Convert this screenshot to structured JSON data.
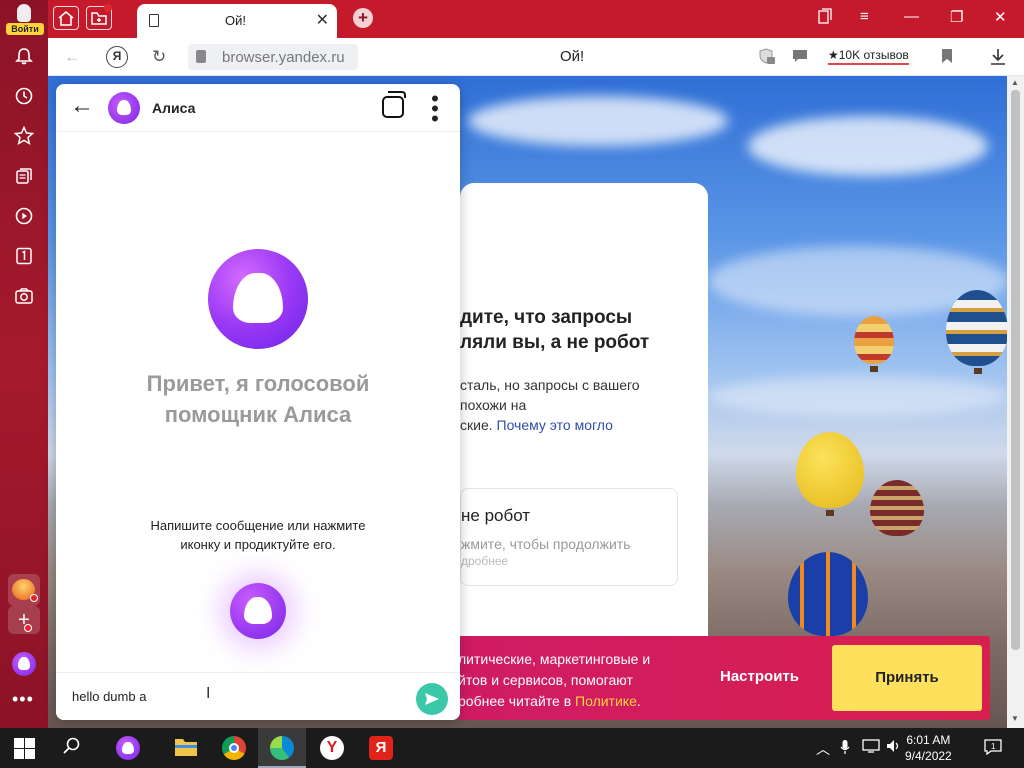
{
  "sidebar": {
    "login_label": "Войти"
  },
  "tabbar": {
    "tab_title": "Ой!",
    "close_glyph": "✕",
    "new_tab_glyph": "+"
  },
  "addressbar": {
    "url": "browser.yandex.ru",
    "page_title": "Ой!",
    "reviews": "★10K отзывов"
  },
  "page": {
    "heading": "дите, что запросы\nляли вы, а не робот",
    "paragraph_lines": [
      "сталь, но запросы с вашего",
      "похожи на",
      "ские."
    ],
    "paragraph_link": "Почему это могло",
    "check_title": "не робот",
    "check_sub": "жмите, чтобы продолжить",
    "check_more": "дробнее",
    "banner_lines": [
      "литические, маркетинговые и",
      "йтов и сервисов, помогают",
      "робнее читайте в"
    ],
    "banner_link": "Политике",
    "banner_period": ".",
    "configure_label": "Настроить",
    "accept_label": "Принять"
  },
  "alice": {
    "title": "Алиса",
    "greeting_line1": "Привет, я голосовой",
    "greeting_line2": "помощник Алиса",
    "hint_line1": "Напишите сообщение или нажмите",
    "hint_line2": "иконку и продиктуйте его.",
    "input_value": "hello dumb a"
  },
  "taskbar": {
    "time": "6:01 AM",
    "date": "9/4/2022"
  },
  "colors": {
    "browser_accent": "#a51a2c",
    "alice_purple": "#8a2fef",
    "send_green": "#3bc8a8",
    "accept_yellow": "#ffe05c"
  }
}
